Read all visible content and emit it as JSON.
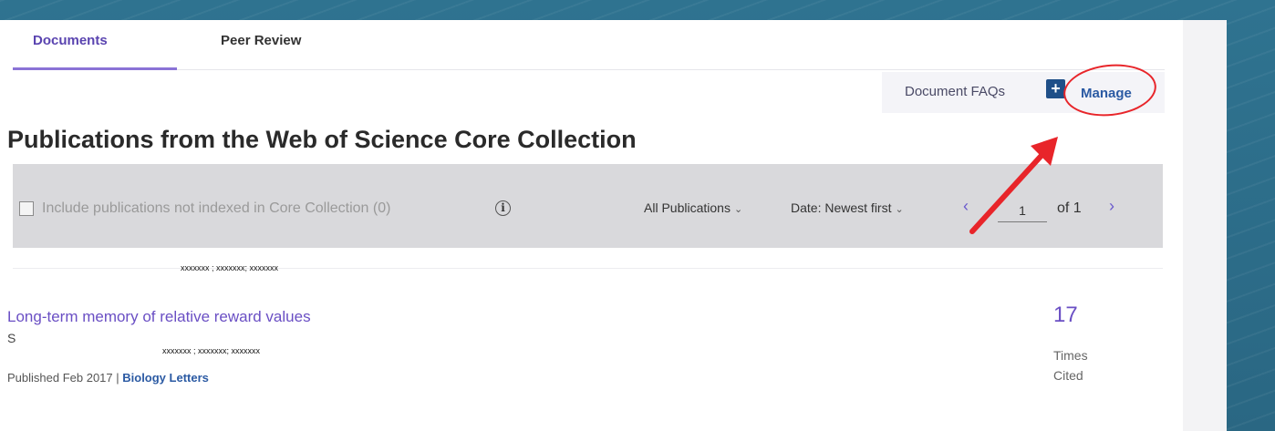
{
  "tabs": [
    {
      "label": "Documents",
      "active": true
    },
    {
      "label": "Peer Review",
      "active": false
    }
  ],
  "actions": {
    "faq_label": "Document FAQs",
    "plus_glyph": "+",
    "manage_label": "Manage"
  },
  "page_title": "Publications from the Web of Science Core Collection",
  "filters": {
    "include_label": "Include publications not indexed in Core Collection (0)",
    "info_glyph": "i",
    "publications_select": "All Publications",
    "sort_select": "Date: Newest first",
    "prev_glyph": "‹",
    "next_glyph": "›",
    "page_value": "1",
    "of_label": "of 1"
  },
  "results": [
    {
      "authors_top": "xxxxxxx ; xxxxxxx; xxxxxxx",
      "title": "Long-term memory of relative reward values",
      "fragment": "S",
      "authors_inline": "xxxxxxx ; xxxxxxx; xxxxxxx",
      "published_prefix": "Published Feb 2017 | ",
      "journal": "Biology Letters",
      "times_cited": "17",
      "times_label": "Times",
      "cited_label": "Cited"
    }
  ],
  "colors": {
    "accent": "#6a4fc4",
    "link": "#2b5aa3",
    "annotation": "#e8252a",
    "filter_bar": "#d9d9dc",
    "background": "#2c6b85"
  },
  "icons": {
    "add": "plus-square-icon",
    "info": "info-circle-icon",
    "chevron": "chevron-down-icon"
  }
}
